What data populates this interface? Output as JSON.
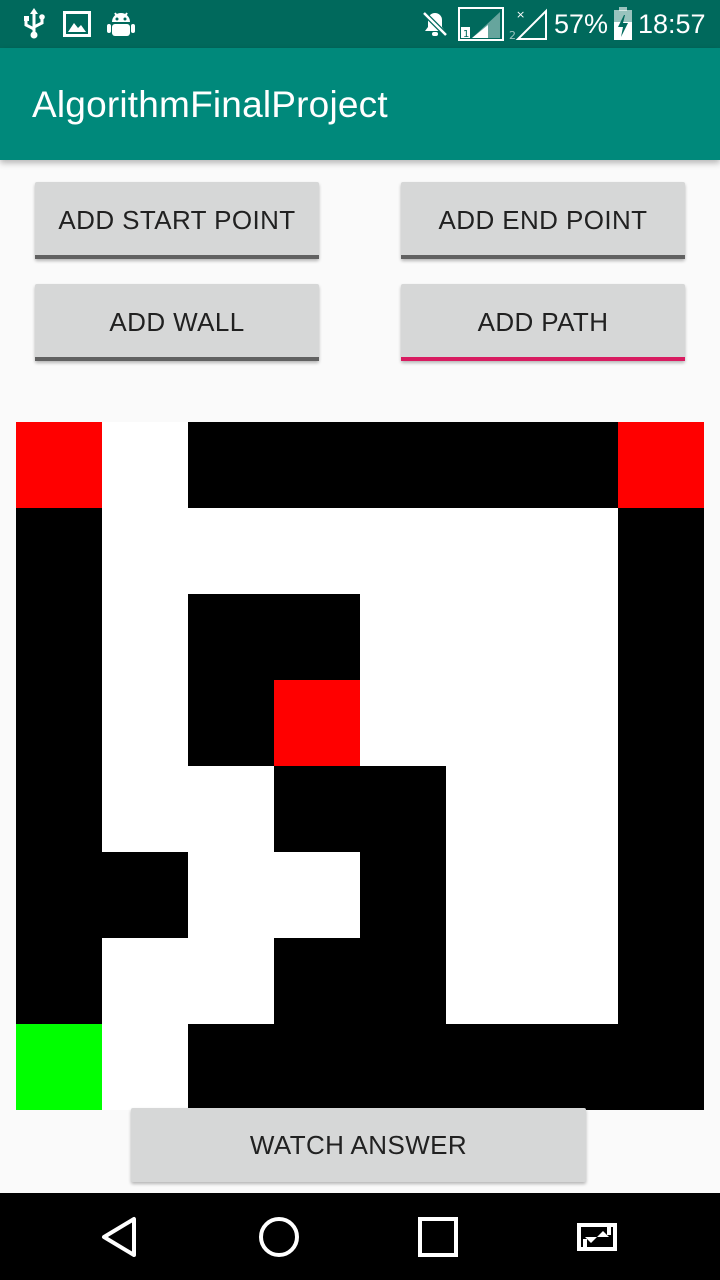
{
  "status_bar": {
    "icons": [
      "usb-icon",
      "image-icon",
      "android-debug-icon",
      "mute-icon",
      "signal-sim1-icon",
      "signal-sim2-icon",
      "battery-charging-icon"
    ],
    "battery": "57%",
    "time": "18:57"
  },
  "app_bar": {
    "title": "AlgorithmFinalProject"
  },
  "buttons": {
    "add_start": "ADD START POINT",
    "add_end": "ADD END POINT",
    "add_wall": "ADD WALL",
    "add_path": "ADD PATH",
    "watch_answer": "WATCH ANSWER"
  },
  "colors": {
    "status_bar": "#00695c",
    "app_bar": "#00897b",
    "accent": "#d81b60",
    "start": "#00ff00",
    "end": "#ff0000",
    "wall": "#000000",
    "path": "#ffffff"
  },
  "maze": {
    "legend": {
      "R": "end",
      "B": "wall",
      "W": "path",
      "G": "start"
    },
    "rows": [
      [
        "R",
        "W",
        "B",
        "B",
        "B",
        "B",
        "B",
        "R"
      ],
      [
        "B",
        "W",
        "W",
        "W",
        "W",
        "W",
        "W",
        "B"
      ],
      [
        "B",
        "W",
        "B",
        "B",
        "W",
        "W",
        "W",
        "B"
      ],
      [
        "B",
        "W",
        "B",
        "R",
        "W",
        "W",
        "W",
        "B"
      ],
      [
        "B",
        "W",
        "W",
        "B",
        "B",
        "W",
        "W",
        "B"
      ],
      [
        "B",
        "B",
        "W",
        "W",
        "B",
        "W",
        "W",
        "B"
      ],
      [
        "B",
        "W",
        "W",
        "B",
        "B",
        "W",
        "W",
        "B"
      ],
      [
        "G",
        "W",
        "B",
        "B",
        "B",
        "B",
        "B",
        "B"
      ]
    ]
  },
  "nav_bar": {
    "icons": [
      "back-icon",
      "home-icon",
      "recents-icon",
      "screen-rotate-icon"
    ]
  }
}
